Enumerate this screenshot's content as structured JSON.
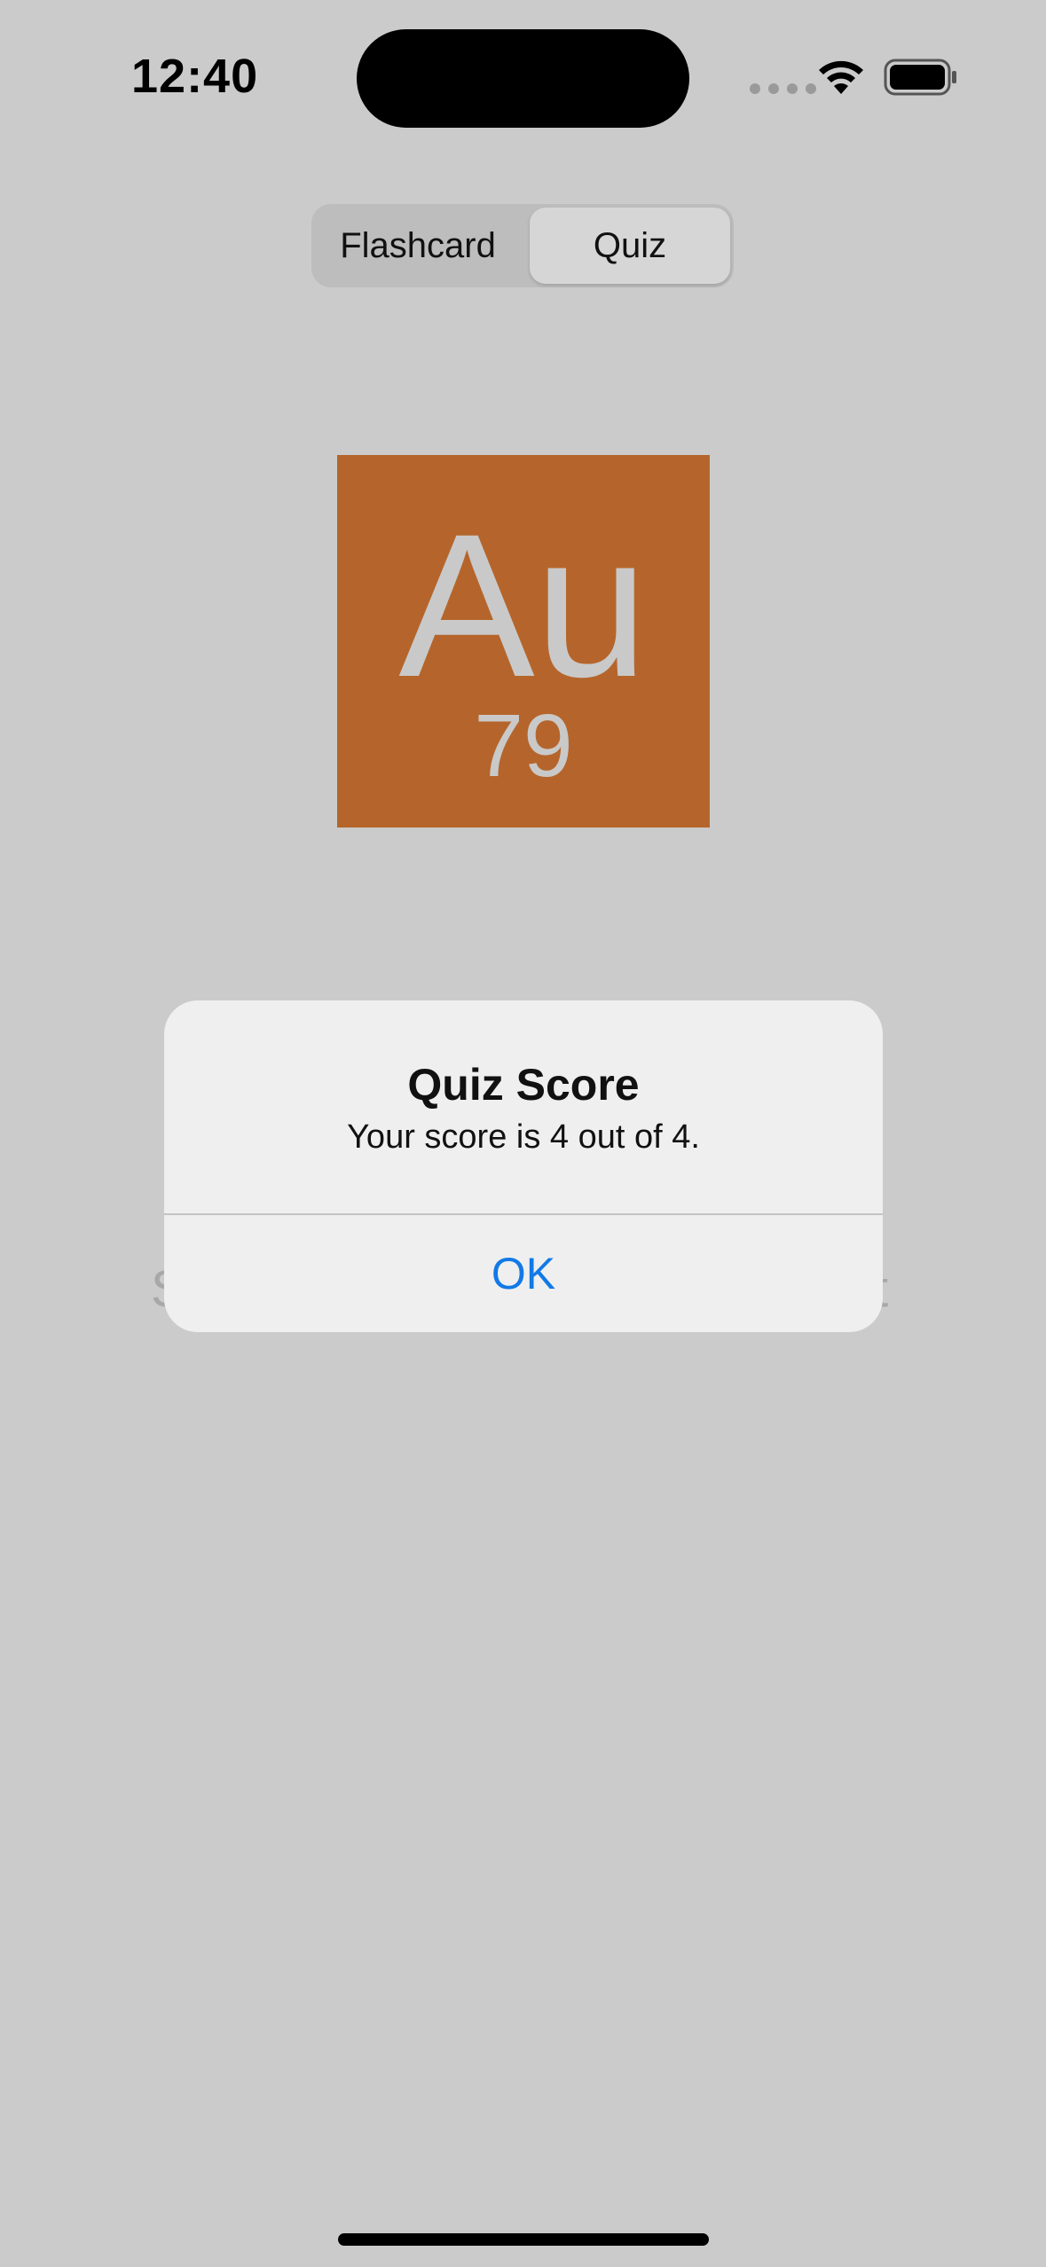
{
  "status_bar": {
    "time": "12:40",
    "icons": [
      "cellular-dots-icon",
      "wifi-icon",
      "battery-icon"
    ]
  },
  "segmented_control": {
    "options": [
      "Flashcard",
      "Quiz"
    ],
    "selected": "Quiz"
  },
  "element": {
    "symbol": "Au",
    "number": "79",
    "tile_color": "#b5652b"
  },
  "background_text": {
    "left_fragment": "S",
    "right_fragment": "t"
  },
  "alert": {
    "title": "Quiz Score",
    "message": "Your score is 4 out of 4.",
    "ok_label": "OK"
  },
  "colors": {
    "background": "#cbcbcb",
    "accent": "#1279e6"
  }
}
